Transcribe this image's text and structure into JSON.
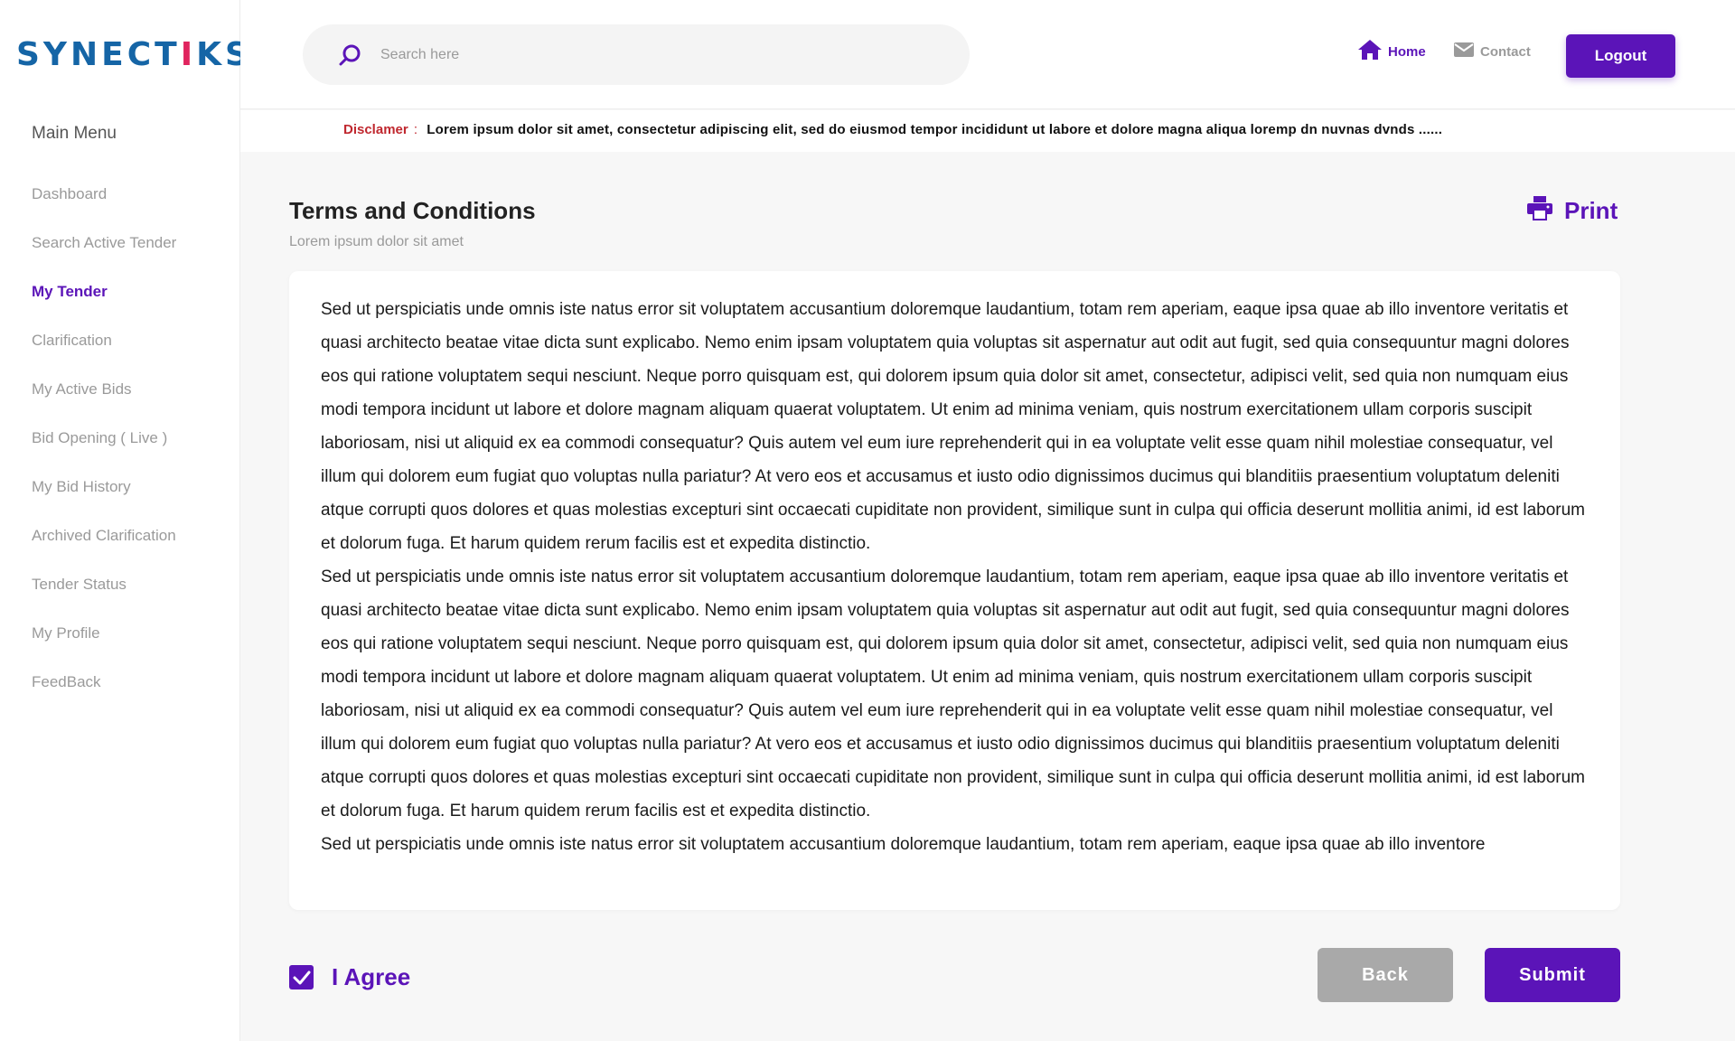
{
  "brand": {
    "logo_pre": "SYNECT",
    "logo_i": "I",
    "logo_post": "KS"
  },
  "sidebar": {
    "title": "Main Menu",
    "items": [
      {
        "label": "Dashboard"
      },
      {
        "label": "Search Active Tender"
      },
      {
        "label": "My Tender"
      },
      {
        "label": "Clarification"
      },
      {
        "label": "My Active Bids"
      },
      {
        "label": "Bid Opening ( Live )"
      },
      {
        "label": "My Bid History"
      },
      {
        "label": "Archived Clarification"
      },
      {
        "label": "Tender Status"
      },
      {
        "label": "My Profile"
      },
      {
        "label": "FeedBack"
      }
    ],
    "active_item": "My Tender"
  },
  "header": {
    "search_placeholder": "Search here",
    "search_value": "",
    "home_label": "Home",
    "contact_label": "Contact",
    "logout_label": "Logout"
  },
  "disclaimer": {
    "label": "Disclamer",
    "separator": ":",
    "text": "Lorem ipsum dolor sit amet, consectetur adipiscing elit, sed do eiusmod tempor incididunt ut labore et dolore magna aliqua loremp dn  nuvnas dvnds ......"
  },
  "page": {
    "title": "Terms and Conditions",
    "subtitle": "Lorem ipsum dolor sit amet",
    "print_label": "Print"
  },
  "terms": {
    "paragraphs": [
      "Sed ut perspiciatis unde omnis iste natus error sit voluptatem accusantium doloremque laudantium, totam rem aperiam, eaque ipsa quae ab illo inventore veritatis et quasi architecto beatae vitae dicta sunt explicabo. Nemo enim ipsam voluptatem quia voluptas sit aspernatur aut odit aut fugit, sed quia consequuntur magni dolores eos qui ratione voluptatem sequi nesciunt. Neque porro quisquam est, qui dolorem ipsum quia dolor sit amet, consectetur, adipisci velit, sed quia non numquam eius modi tempora incidunt ut labore et dolore magnam aliquam quaerat voluptatem. Ut enim ad minima veniam, quis nostrum exercitationem ullam corporis suscipit laboriosam, nisi ut aliquid ex ea commodi consequatur? Quis autem vel eum iure reprehenderit qui in ea voluptate velit esse quam nihil molestiae consequatur, vel illum qui dolorem eum fugiat quo voluptas nulla pariatur? At vero eos et accusamus et iusto odio dignissimos ducimus qui blanditiis praesentium voluptatum deleniti atque corrupti quos dolores et quas molestias excepturi sint occaecati cupiditate non provident, similique sunt in culpa qui officia deserunt mollitia animi, id est laborum et dolorum fuga. Et harum quidem rerum facilis est et expedita distinctio.",
      "Sed ut perspiciatis unde omnis iste natus error sit voluptatem accusantium doloremque laudantium, totam rem aperiam, eaque ipsa quae ab illo inventore veritatis et quasi architecto beatae vitae dicta sunt explicabo. Nemo enim ipsam voluptatem quia voluptas sit aspernatur aut odit aut fugit, sed quia consequuntur magni dolores eos qui ratione voluptatem sequi nesciunt. Neque porro quisquam est, qui dolorem ipsum quia dolor sit amet, consectetur, adipisci velit, sed quia non numquam eius modi tempora incidunt ut labore et dolore magnam aliquam quaerat voluptatem. Ut enim ad minima veniam, quis nostrum exercitationem ullam corporis suscipit laboriosam, nisi ut aliquid ex ea commodi consequatur? Quis autem vel eum iure reprehenderit qui in ea voluptate velit esse quam nihil molestiae consequatur, vel illum qui dolorem eum fugiat quo voluptas nulla pariatur? At vero eos et accusamus et iusto odio dignissimos ducimus qui blanditiis praesentium voluptatum deleniti atque corrupti quos dolores et quas molestias excepturi sint occaecati cupiditate non provident, similique sunt in culpa qui officia deserunt mollitia animi, id est laborum et dolorum fuga. Et harum quidem rerum facilis est et expedita distinctio.",
      "Sed ut perspiciatis unde omnis iste natus error sit voluptatem accusantium doloremque laudantium, totam rem aperiam, eaque ipsa quae ab illo inventore"
    ]
  },
  "actions": {
    "agree_label": "I Agree",
    "agree_checked": true,
    "back_label": "Back",
    "submit_label": "Submit"
  },
  "colors": {
    "accent": "#5b14b8",
    "brand_blue": "#1565a6",
    "brand_pink": "#e0245e",
    "disclaimer_red": "#c0282f",
    "button_gray": "#a9a9a9"
  },
  "icons": {
    "search": "search-icon",
    "home": "home-icon",
    "contact": "envelope-icon",
    "print": "printer-icon",
    "check": "checkmark-icon"
  }
}
